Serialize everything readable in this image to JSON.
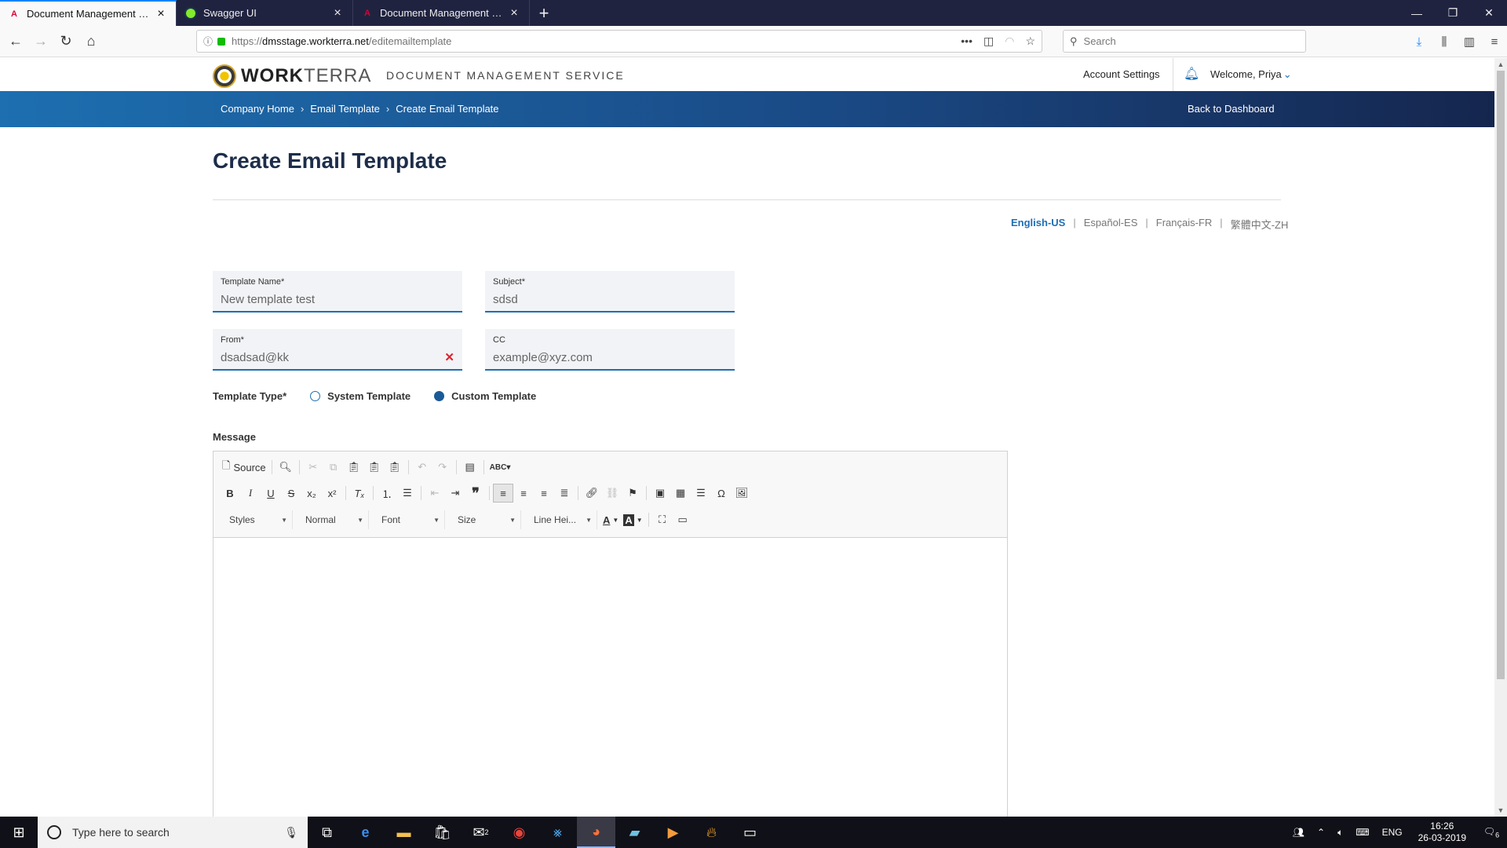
{
  "browser": {
    "tabs": [
      {
        "title": "Document Management Servic",
        "icon": "angular-icon",
        "active": true
      },
      {
        "title": "Swagger UI",
        "icon": "swagger-icon",
        "active": false
      },
      {
        "title": "Document Management Servic",
        "icon": "angular-icon",
        "active": false
      }
    ],
    "url": {
      "protocol": "https://",
      "host": "dmsstage.workterra.net",
      "path": "/editemailtemplate"
    },
    "search_placeholder": "Search"
  },
  "header": {
    "logo_bold": "WORK",
    "logo_light": "TERRA",
    "app_name": "DOCUMENT MANAGEMENT SERVICE",
    "account_settings": "Account Settings",
    "welcome": "Welcome, Priya"
  },
  "breadcrumb": {
    "items": [
      "Company Home",
      "Email Template",
      "Create Email Template"
    ],
    "back_label": "Back to Dashboard"
  },
  "page": {
    "title": "Create Email Template"
  },
  "languages": {
    "active": "English-US",
    "others": [
      "Español-ES",
      "Français-FR",
      "繁體中文-ZH"
    ]
  },
  "form": {
    "template_name": {
      "label": "Template Name*",
      "value": "New template test"
    },
    "subject": {
      "label": "Subject*",
      "value": "sdsd"
    },
    "from": {
      "label": "From*",
      "value": "dsadsad@kk"
    },
    "cc": {
      "label": "CC",
      "value": "",
      "placeholder": "example@xyz.com"
    },
    "template_type": {
      "label": "Template Type*",
      "options": [
        "System Template",
        "Custom Template"
      ],
      "selected": "Custom Template"
    },
    "message_label": "Message"
  },
  "editor": {
    "source_label": "Source",
    "combos": [
      "Styles",
      "Normal",
      "Font",
      "Size",
      "Line Hei..."
    ]
  },
  "taskbar": {
    "search_placeholder": "Type here to search",
    "language": "ENG",
    "time": "16:26",
    "date": "26-03-2019",
    "notifications": "6",
    "mail_badge": "2"
  },
  "colors": {
    "accent": "#1e6fb5",
    "bar_start": "#1d6fb0",
    "bar_end": "#15264e",
    "title": "#1d2d4a",
    "error": "#e0202a"
  }
}
